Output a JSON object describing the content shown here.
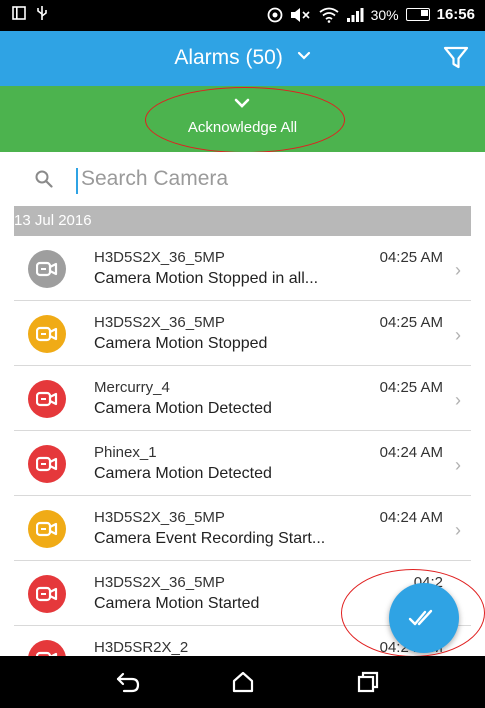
{
  "status_bar": {
    "battery_percent": "30%",
    "time": "16:56",
    "icons": [
      "phone-portrait-icon",
      "usb-icon",
      "alarm-clock-icon",
      "mute-icon",
      "wifi-icon",
      "signal-icon",
      "battery-icon"
    ]
  },
  "app_bar": {
    "title": "Alarms (50)",
    "dropdown_icon": "chevron-down-icon",
    "filter_icon": "filter-icon"
  },
  "acknowledge": {
    "label": "Acknowledge All",
    "icon": "chevron-down-icon"
  },
  "search": {
    "placeholder": "Search Camera",
    "value": ""
  },
  "date_header": "13 Jul 2016",
  "colors": {
    "app_bar": "#2fa3e4",
    "acknowledge_bar": "#4cb34e",
    "grey": "#9e9e9e",
    "orange": "#f0ab16",
    "red": "#e5383b"
  },
  "alarms": [
    {
      "camera": "H3D5S2X_36_5MP",
      "event": "Camera Motion Stopped in all...",
      "time": "04:25 AM",
      "severity": "grey"
    },
    {
      "camera": "H3D5S2X_36_5MP",
      "event": "Camera Motion Stopped",
      "time": "04:25 AM",
      "severity": "orange"
    },
    {
      "camera": "Mercurry_4",
      "event": "Camera Motion Detected",
      "time": "04:25 AM",
      "severity": "red"
    },
    {
      "camera": "Phinex_1",
      "event": "Camera Motion Detected",
      "time": "04:24 AM",
      "severity": "red"
    },
    {
      "camera": "H3D5S2X_36_5MP",
      "event": "Camera Event Recording Start...",
      "time": "04:24 AM",
      "severity": "orange"
    },
    {
      "camera": "H3D5S2X_36_5MP",
      "event": "Camera Motion Started",
      "time": "04:2",
      "severity": "red"
    },
    {
      "camera": "H3D5SR2X_2",
      "event": "",
      "time": "04:24 AM",
      "severity": "red"
    }
  ],
  "fab": {
    "icon": "double-check-icon"
  },
  "nav": {
    "back_icon": "back-icon",
    "home_icon": "home-icon",
    "recents_icon": "recents-icon"
  }
}
